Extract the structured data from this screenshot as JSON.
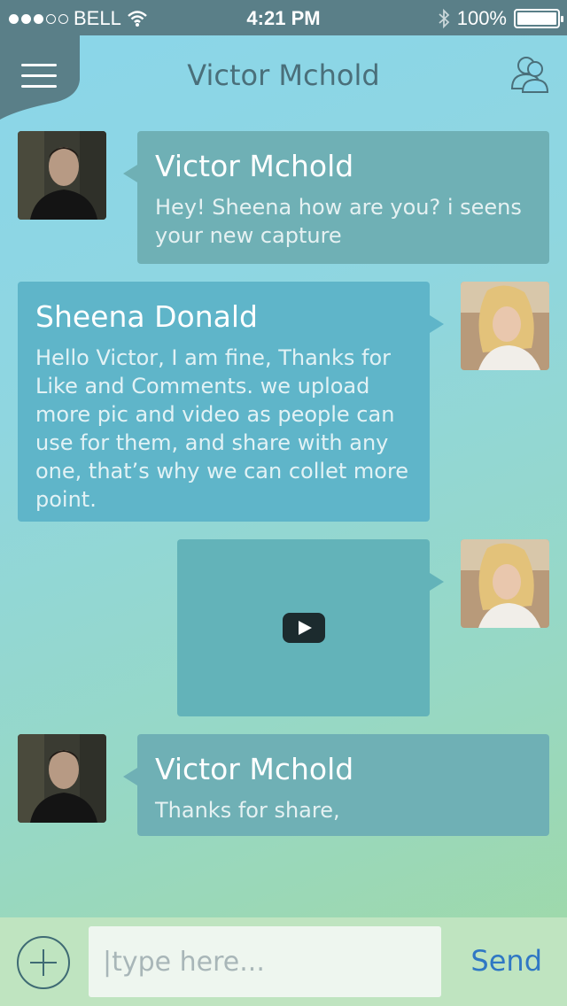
{
  "status_bar": {
    "carrier": "BELL",
    "time": "4:21 PM",
    "battery": "100%",
    "signal_strength": 3,
    "signal_max": 5
  },
  "header": {
    "title": "Victor Mchold",
    "menu_icon": "hamburger-icon",
    "contacts_icon": "contacts-icon"
  },
  "messages": [
    {
      "sender": "Victor Mchold",
      "side": "left",
      "text": "Hey! Sheena how are you? i seens your new capture"
    },
    {
      "sender": "Sheena Donald",
      "side": "right",
      "text": "Hello Victor, I am fine, Thanks for Like and Comments. we upload more pic and video as people can use for them, and share with any one, that’s why we can collet more point."
    },
    {
      "sender": "",
      "side": "right",
      "type": "video",
      "icon": "play-icon"
    },
    {
      "sender": "Victor Mchold",
      "side": "left",
      "text": "Thanks for share,"
    }
  ],
  "input_bar": {
    "placeholder": "|type here...",
    "send_label": "Send",
    "add_icon": "plus-circle-icon"
  },
  "colors": {
    "status_bar": "#5a7f88",
    "title": "#4a6f7a",
    "send": "#2f77c4",
    "bubble_victor": "#6fb0b5",
    "bubble_sheena": "#5fb5c9"
  }
}
